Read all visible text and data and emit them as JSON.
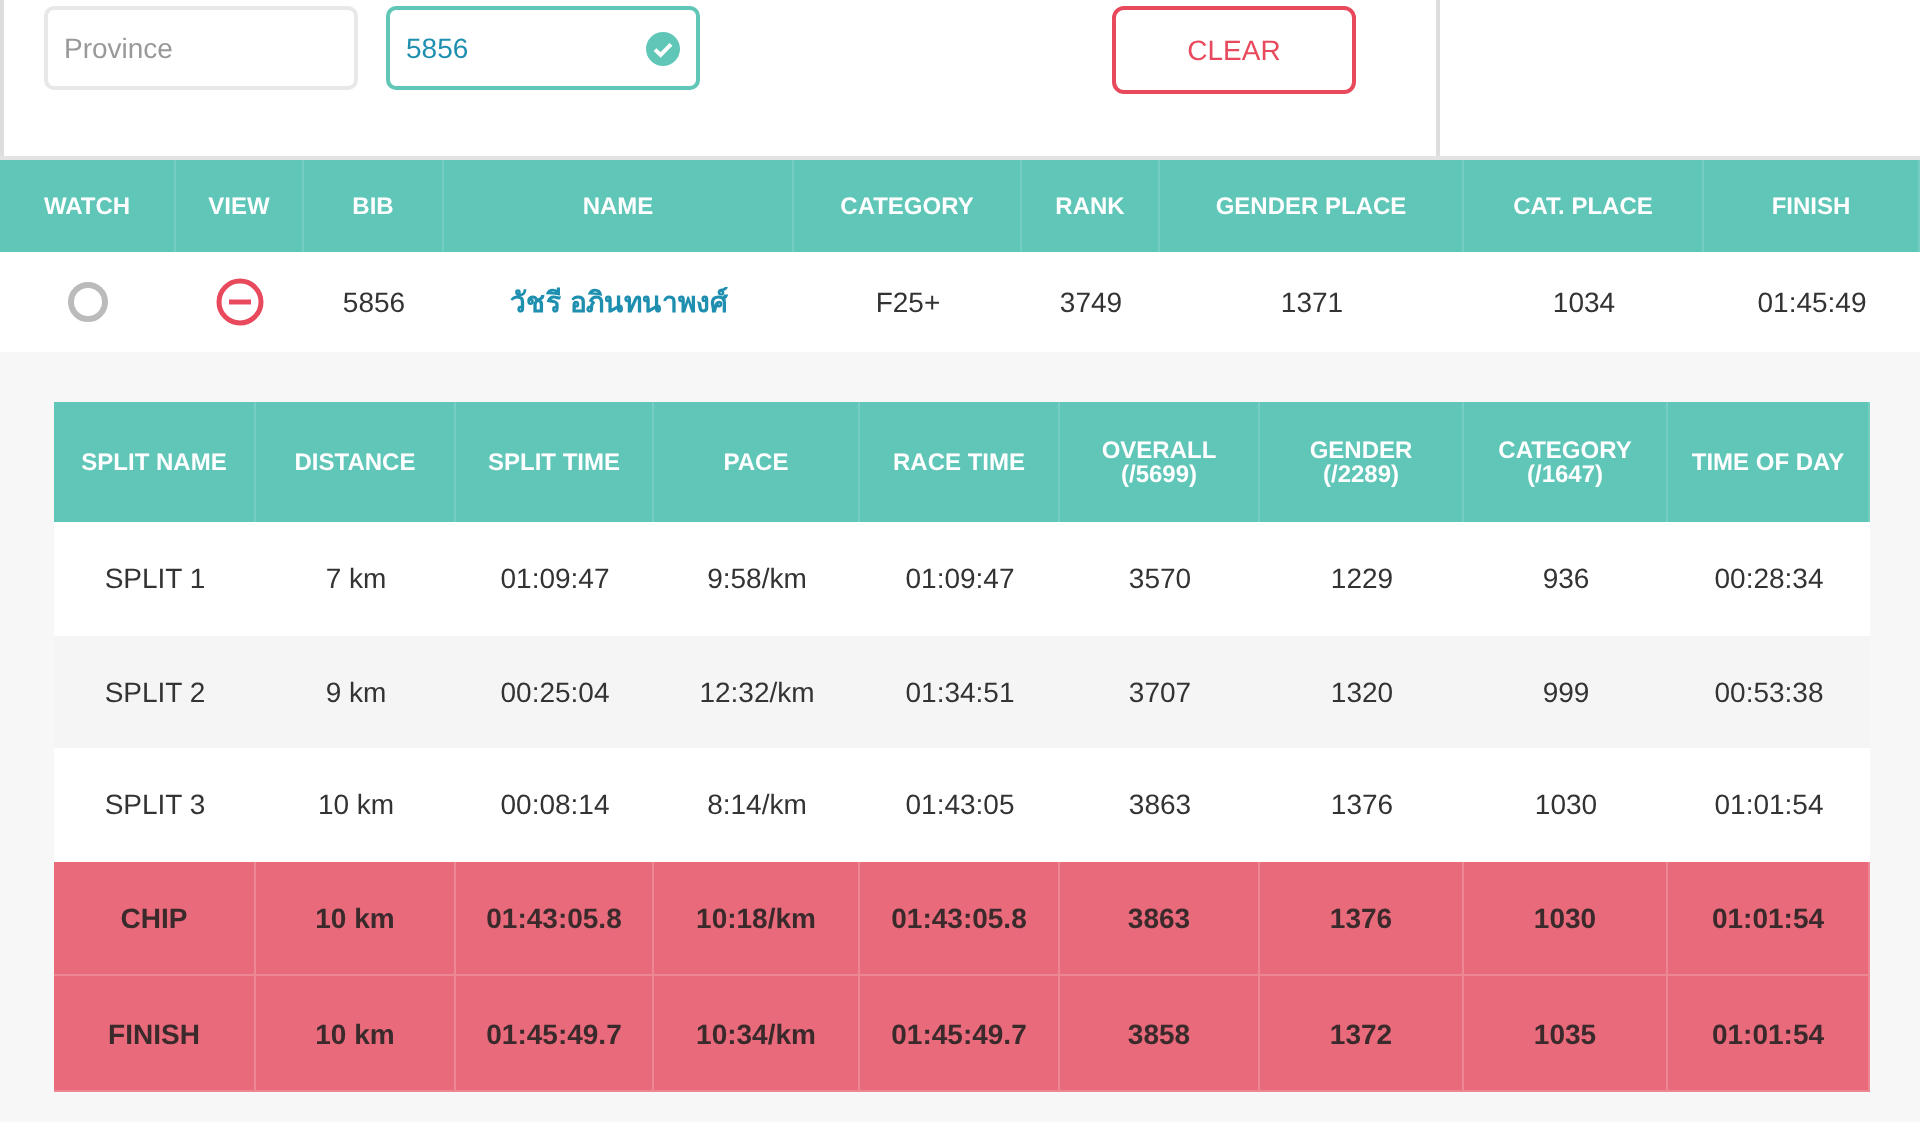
{
  "filters": {
    "province": {
      "placeholder": "Province"
    },
    "bib": {
      "value": "5856",
      "valid": true
    },
    "clear_button": "CLEAR"
  },
  "results": {
    "columns": [
      "WATCH",
      "VIEW",
      "BIB",
      "NAME",
      "CATEGORY",
      "RANK",
      "GENDER PLACE",
      "CAT. PLACE",
      "FINISH"
    ],
    "rows": [
      {
        "watched": false,
        "expanded": true,
        "bib": "5856",
        "name": "วัชรี อภินทนาพงศ์",
        "category": "F25+",
        "rank": "3749",
        "gender_place": "1371",
        "cat_place": "1034",
        "finish": "01:45:49"
      }
    ]
  },
  "splits": {
    "columns": [
      "SPLIT NAME",
      "DISTANCE",
      "SPLIT TIME",
      "PACE",
      "RACE TIME",
      "OVERALL (/5699)",
      "GENDER (/2289)",
      "CATEGORY (/1647)",
      "TIME OF DAY"
    ],
    "rows": [
      {
        "kind": "split",
        "cells": [
          "SPLIT 1",
          "7 km",
          "01:09:47",
          "9:58/km",
          "01:09:47",
          "3570",
          "1229",
          "936",
          "00:28:34"
        ]
      },
      {
        "kind": "split",
        "cells": [
          "SPLIT 2",
          "9 km",
          "00:25:04",
          "12:32/km",
          "01:34:51",
          "3707",
          "1320",
          "999",
          "00:53:38"
        ]
      },
      {
        "kind": "split",
        "cells": [
          "SPLIT 3",
          "10 km",
          "00:08:14",
          "8:14/km",
          "01:43:05",
          "3863",
          "1376",
          "1030",
          "01:01:54"
        ]
      },
      {
        "kind": "total",
        "cells": [
          "CHIP",
          "10 km",
          "01:43:05.8",
          "10:18/km",
          "01:43:05.8",
          "3863",
          "1376",
          "1030",
          "01:01:54"
        ]
      },
      {
        "kind": "total",
        "cells": [
          "FINISH",
          "10 km",
          "01:45:49.7",
          "10:34/km",
          "01:45:49.7",
          "3858",
          "1372",
          "1035",
          "01:01:54"
        ]
      }
    ]
  }
}
